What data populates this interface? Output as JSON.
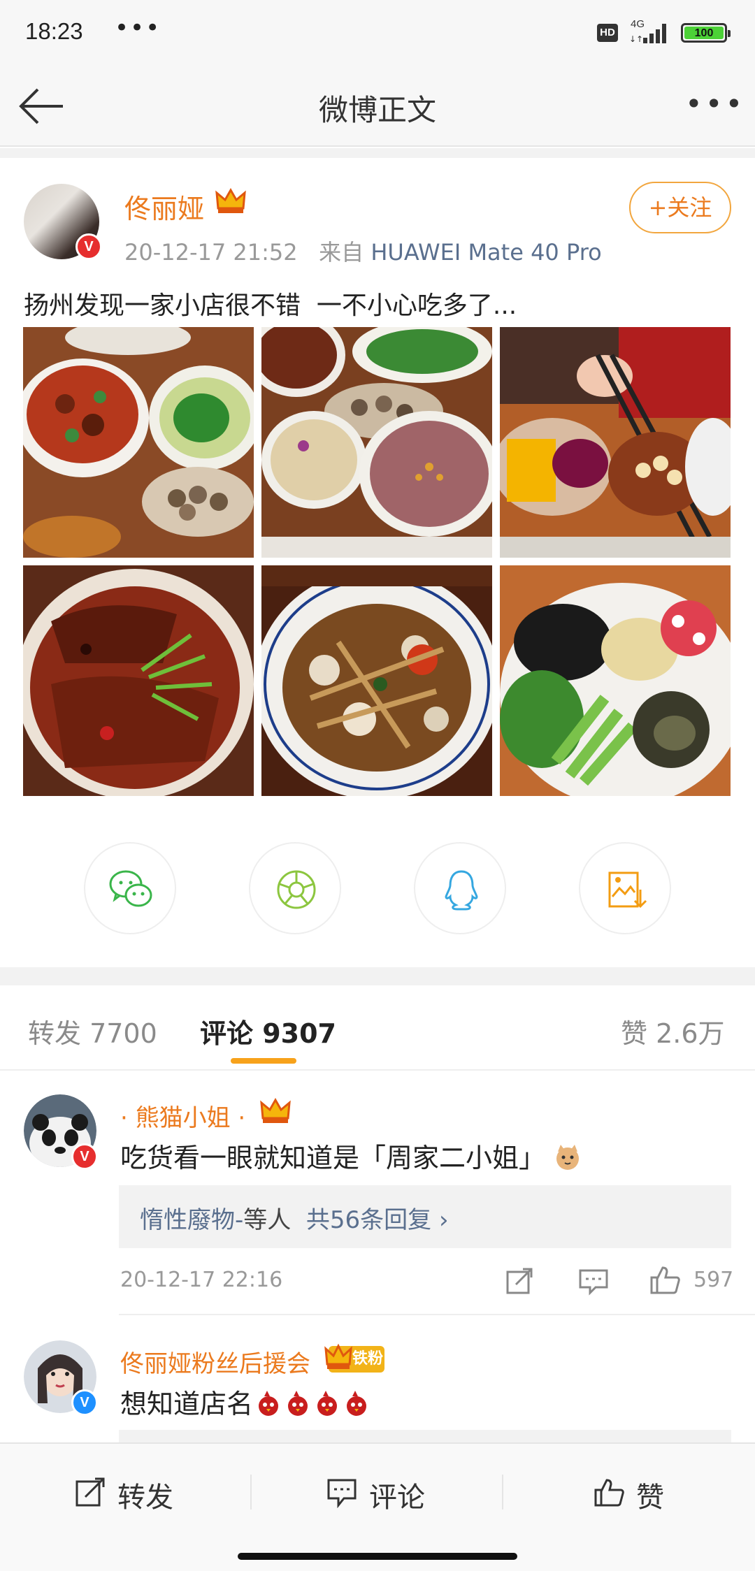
{
  "status_bar": {
    "time": "18:23",
    "overflow": "•••",
    "hd": "HD",
    "network": "4G",
    "battery": "100"
  },
  "nav": {
    "title": "微博正文",
    "more": "•••",
    "back_icon": "arrow-left-icon"
  },
  "post": {
    "author": "佟丽娅",
    "timestamp": "20-12-17 21:52",
    "source_prefix": "来自",
    "source": "HUAWEI Mate 40 Pro",
    "follow_label": "+关注",
    "text": "扬州发现一家小店很不错  一不小心吃多了...",
    "photos": [
      "stew-and-snails",
      "congee-and-snails",
      "fruit-dessert-chopsticks",
      "braised-fish",
      "stir-fried-chicken",
      "cold-dish-platter"
    ]
  },
  "share": {
    "icons": [
      "wechat-icon",
      "moments-icon",
      "qq-icon",
      "save-image-icon"
    ]
  },
  "tabs": {
    "repost": "转发 7700",
    "comments": "评论 9307",
    "likes": "赞 2.6万"
  },
  "comments": [
    {
      "name": "· 熊猫小姐 ·",
      "text": "吃货看一眼就知道是「周家二小姐」",
      "reply_user": "惰性廢物-",
      "reply_mid": "等人",
      "reply_count": "共56条回复",
      "reply_chevron": "›",
      "time": "20-12-17 22:16",
      "likes": "597"
    },
    {
      "name": "佟丽娅粉丝后援会",
      "badge": "铁粉",
      "text": "想知道店名"
    }
  ],
  "bottom_bar": {
    "repost": "转发",
    "comment": "评论",
    "like": "赞"
  },
  "colors": {
    "accent_orange": "#eb7a1e",
    "link_blue": "#5a6f8e",
    "tab_underline": "#f7a21b"
  }
}
